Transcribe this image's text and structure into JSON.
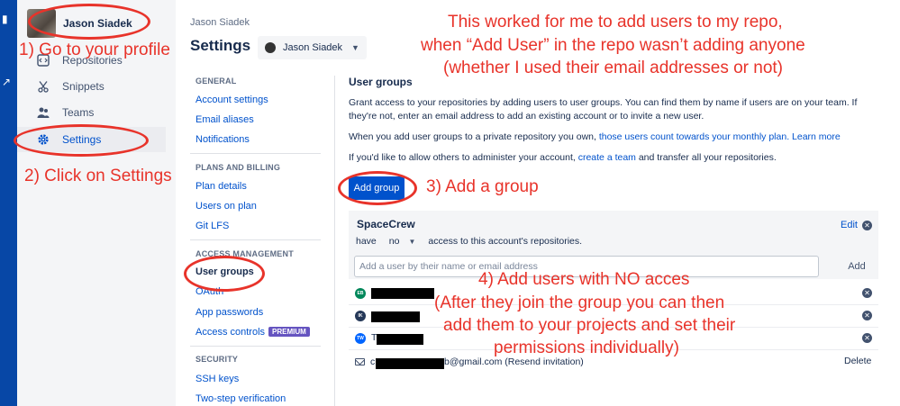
{
  "profile": {
    "name": "Jason Siadek"
  },
  "sidebar": {
    "items": [
      {
        "label": "Repositories",
        "icon": "code-icon"
      },
      {
        "label": "Snippets",
        "icon": "scissors-icon"
      },
      {
        "label": "Teams",
        "icon": "people-icon"
      },
      {
        "label": "Settings",
        "icon": "gear-icon",
        "active": true
      }
    ]
  },
  "header": {
    "breadcrumb": "Jason Siadek",
    "title": "Settings",
    "account_selector": "Jason Siadek"
  },
  "settings_nav": {
    "general_heading": "GENERAL",
    "account_settings": "Account settings",
    "email_aliases": "Email aliases",
    "notifications": "Notifications",
    "plans_heading": "PLANS AND BILLING",
    "plan_details": "Plan details",
    "users_on_plan": "Users on plan",
    "git_lfs": "Git LFS",
    "access_heading": "ACCESS MANAGEMENT",
    "user_groups": "User groups",
    "oauth": "OAuth",
    "app_passwords": "App passwords",
    "access_controls": "Access controls",
    "premium_badge": "PREMIUM",
    "security_heading": "SECURITY",
    "ssh_keys": "SSH keys",
    "two_step": "Two-step verification"
  },
  "main": {
    "title": "User groups",
    "intro_1": "Grant access to your repositories by adding users to user groups. You can find them by name if users are on your team. If they're not, enter an email address to add an existing account or to invite a new user.",
    "intro_2_a": "When you add user groups to a private repository you own, ",
    "intro_2_link1": "those users count towards your monthly plan.",
    "intro_2_link2": "Learn more",
    "intro_3_a": "If you'd like to allow others to administer your account, ",
    "intro_3_link": "create a team",
    "intro_3_b": " and transfer all your repositories.",
    "add_group_label": "Add group"
  },
  "group": {
    "name": "SpaceCrew",
    "edit_label": "Edit",
    "access_prefix": "have",
    "access_value": "no",
    "access_suffix": "access to this account's repositories.",
    "add_user_placeholder": "Add a user by their name or email address",
    "add_label": "Add",
    "members": [
      {
        "initials": "EB",
        "color": "#00875a"
      },
      {
        "initials": "IK",
        "color": "#253858"
      },
      {
        "initials": "TW",
        "color": "#0065ff",
        "visible_prefix": "T"
      }
    ],
    "invite": {
      "prefix": "c",
      "suffix": "b@gmail.com (Resend invitation)",
      "delete_label": "Delete"
    }
  },
  "annotations": {
    "heading_line1": "This worked for me to add users to my repo,",
    "heading_line2": "when “Add User” in the repo wasn’t adding anyone",
    "heading_line3": "(whether I used their email addresses or not)",
    "step1": "1) Go to your profile",
    "step2": "2) Click on Settings",
    "step3": "3) Add a group",
    "step4_line1": "4) Add users with NO acces",
    "step4_line2": "(After they join the group you can then",
    "step4_line3": "add them to your projects and set their",
    "step4_line4": "permissions individually)",
    "color": "#e8332a"
  }
}
